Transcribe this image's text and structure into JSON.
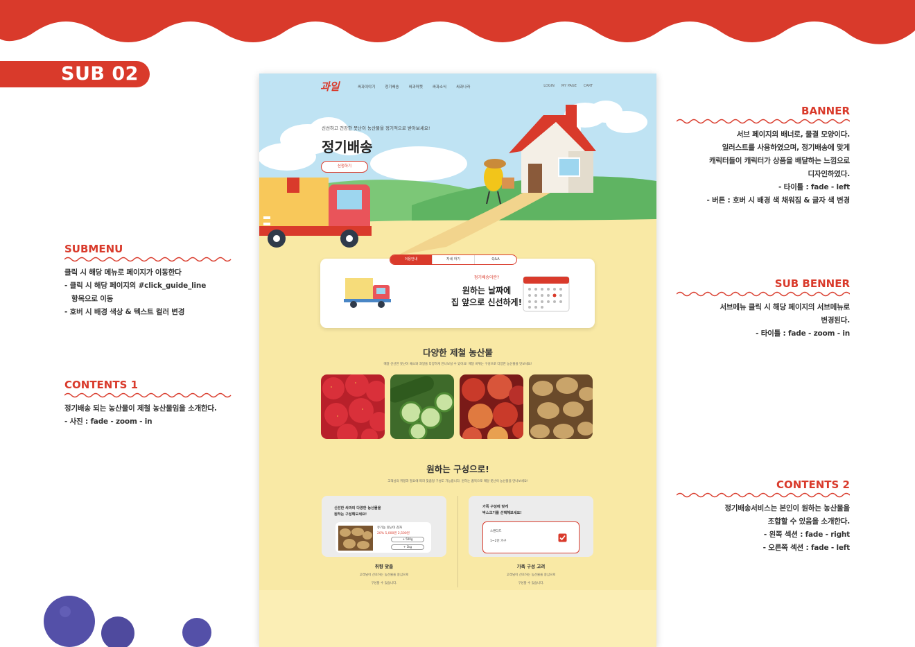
{
  "label": "SUB 02",
  "notes": {
    "banner": {
      "title": "BANNER",
      "lines": [
        "서브 페이지의 배너로, 물결 모양이다.",
        "일러스트를 사용하였으며, 정기배송에 맞게",
        "캐릭터들이 캐릭터가 상품을 배달하는 느낌으로",
        "디자인하였다.",
        "- 타이틀 : fade - left",
        "- 버튼 : 호버 시 배경 색 채워짐 & 글자 색 변경"
      ]
    },
    "submenu": {
      "title": "SUBMENU",
      "lines": [
        "클릭 시 해당 메뉴로 페이지가 이동한다",
        "- 클릭 시 해당 페이지의 #click_guide_line",
        "  항목으로 이동",
        "- 호버 시 배경 색상 & 텍스트 컬러 변경"
      ]
    },
    "subbanner": {
      "title": "SUB BENNER",
      "lines": [
        "서브메뉴 클릭 시 해당 페이지의 서브메뉴로",
        "변경된다.",
        "- 타이틀 : fade - zoom - in"
      ]
    },
    "contents1": {
      "title": "CONTENTS 1",
      "lines": [
        "정기배송 되는 농산물이 제철 농산물임을 소개한다.",
        "- 사진 : fade - zoom - in"
      ]
    },
    "contents2": {
      "title": "CONTENTS 2",
      "lines": [
        "정기배송서비스는 본인이 원하는 농산물을",
        "조합할 수 있음을 소개한다.",
        "- 왼쪽 섹션 : fade - right",
        "- 오른쪽 섹션 : fade - left"
      ]
    }
  },
  "mock": {
    "logo": "과일",
    "menu": [
      "싸과이야기",
      "정기배송",
      "싸과마켓",
      "싸과소식",
      "싸과나라"
    ],
    "util": [
      "LOGIN",
      "MY PAGE",
      "CART"
    ],
    "hero_sub": "신선하고 건강한 못난이 농산물을 정기적으로 받아보세요!",
    "hero_title": "정기배송",
    "hero_button": "신청하기",
    "tabs": [
      "이용안내",
      "자세 하기",
      "Q&A"
    ],
    "card_question": "정기배송이란?",
    "card_title_1": "원하는 날짜에",
    "card_title_2": "집 앞으로 신선하게!",
    "sec1_title": "다양한 제철 농산물",
    "sec1_desc": "매달 신선한 못난이 채소와 과일을 다양하게 만나보실 수 있어요! 매달 바뀌는 구성으로 다양한 농산물을 맛보세요!",
    "sec2_title": "원하는 구성으로!",
    "sec2_desc": "고객님의 취향과 필요에 따라 맞춤형 구성도 가능합니다. 원하는 품목으로 매달 못난이 농산물을 만나보세요!",
    "left_panel_text_1": "신선한 싸과의 다양한 농산물을",
    "left_panel_text_2": "원하는 구성해보세요!",
    "left_item_name": "유기농 못난이 감자",
    "left_item_price": "20%  5,000원  2,500원",
    "left_opt_1": "+ 500g",
    "left_opt_2": "+ 1kg",
    "right_panel_text_1": "가족 구성에 맞게",
    "right_panel_text_2": "박스크기를 선택해보세요!",
    "right_box_line_1": "스탠다드",
    "right_box_line_2": "1~2인 가구",
    "left_caption": "취향 맞춤",
    "left_caption_desc_1": "고객님이 선호하는 농산물을 중심으로",
    "left_caption_desc_2": "구성할 수 있습니다.",
    "right_caption": "가족 구성 고려",
    "right_caption_desc_1": "고객님이 선호하는 농산물을 중심으로",
    "right_caption_desc_2": "구성할 수 있습니다."
  },
  "colors": {
    "accent": "#d93a2b",
    "sky": "#bfe3f3",
    "hill": "#6bbf6a",
    "ground": "#f9e9a5",
    "berry": "#5450a8"
  },
  "icons": [
    "truck-icon",
    "house-icon",
    "calendar-icon",
    "checkbox-icon",
    "blueberry-icon"
  ]
}
